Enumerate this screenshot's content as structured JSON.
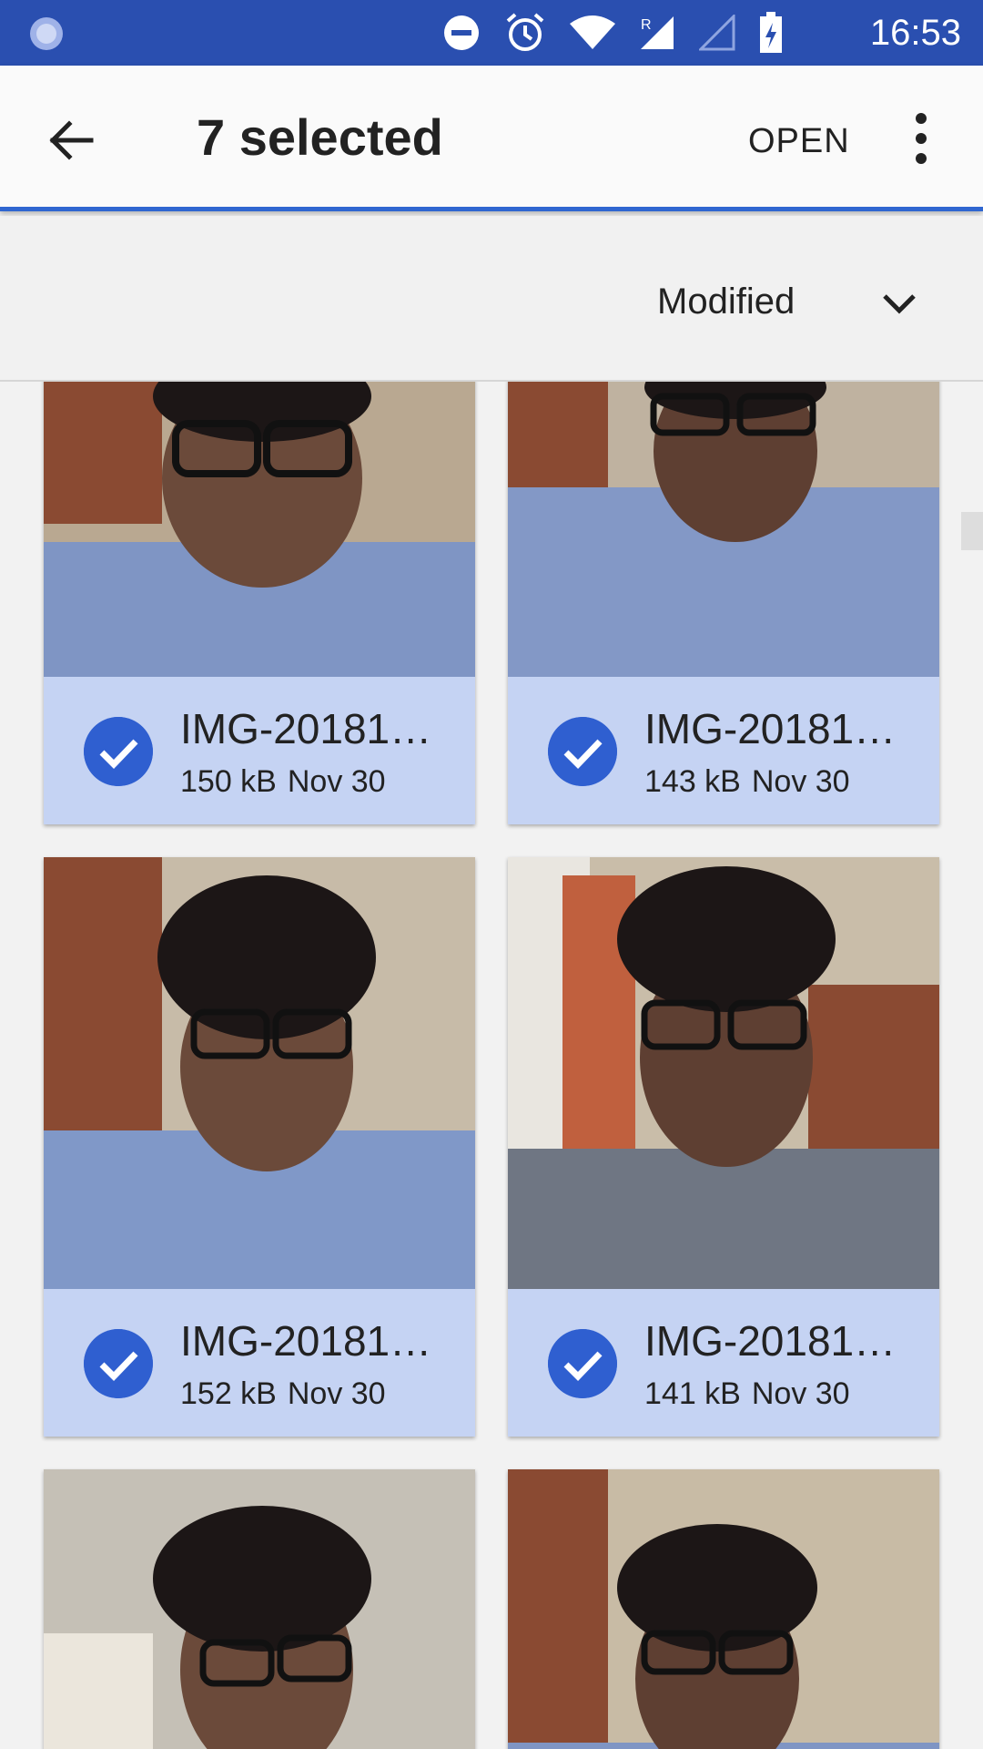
{
  "status_bar": {
    "time": "16:53",
    "icons": [
      "loading-icon",
      "do-not-disturb-icon",
      "alarm-icon",
      "wifi-icon",
      "signal-roaming-icon",
      "signal-empty-icon",
      "battery-charging-icon"
    ]
  },
  "toolbar": {
    "title": "7 selected",
    "open_label": "OPEN"
  },
  "sort": {
    "label": "Modified"
  },
  "files": [
    {
      "name": "IMG-20181…",
      "size": "150 kB",
      "date": "Nov 30",
      "selected": true
    },
    {
      "name": "IMG-20181…",
      "size": "143 kB",
      "date": "Nov 30",
      "selected": true
    },
    {
      "name": "IMG-20181…",
      "size": "152 kB",
      "date": "Nov 30",
      "selected": true
    },
    {
      "name": "IMG-20181…",
      "size": "141 kB",
      "date": "Nov 30",
      "selected": true
    },
    {
      "name": "",
      "size": "",
      "date": "",
      "selected": false
    },
    {
      "name": "",
      "size": "",
      "date": "",
      "selected": false
    }
  ],
  "colors": {
    "status_bar": "#2a4fb0",
    "accent": "#2f66d0",
    "selected_card": "#c5d3f3",
    "check": "#2f5fd0"
  }
}
